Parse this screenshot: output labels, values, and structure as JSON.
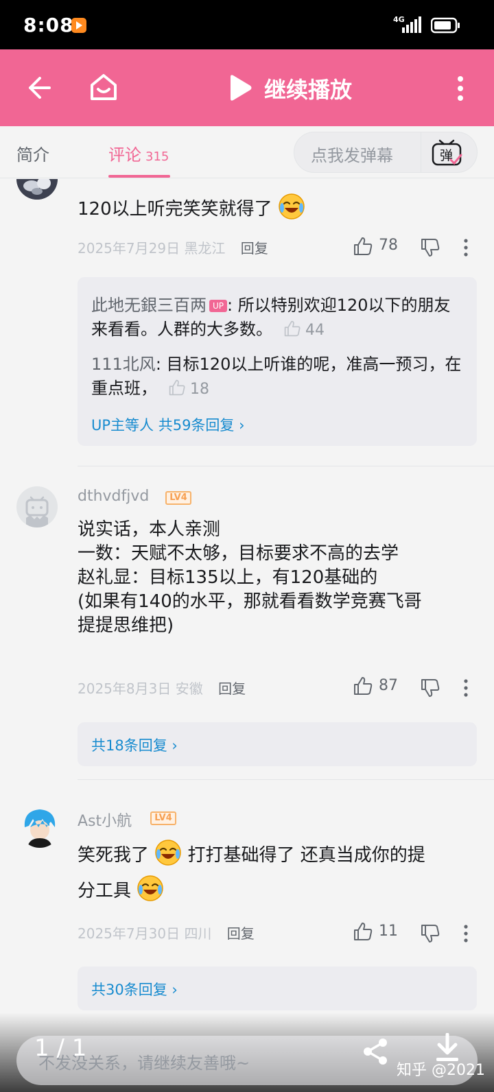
{
  "status_bar": {
    "time": "8:08",
    "network": "4G"
  },
  "header": {
    "continue_label": "继续播放"
  },
  "tabs": {
    "intro": "简介",
    "comments": "评论",
    "comment_count": "315",
    "danmu_placeholder": "点我发弹幕"
  },
  "comments": [
    {
      "text": "120以上听完笑笑就得了",
      "date": "2025年7月29日",
      "location": "黑龙江",
      "reply_label": "回复",
      "likes": "78",
      "sub_replies": [
        {
          "user": "此地无銀三百两",
          "up_badge": "UP",
          "text": "所以特别欢迎120以下的朋友来看看。人群的大多数。",
          "likes": "44"
        },
        {
          "user": "111北风",
          "text": "目标120以上听谁的呢，准高一预习，在重点班，",
          "likes": "18"
        }
      ],
      "more_replies": "UP主等人 共59条回复"
    },
    {
      "user": "dthvdfjvd",
      "level": "LV4",
      "text_lines": [
        "说实话，本人亲测",
        "一数：天赋不太够，目标要求不高的去学",
        "赵礼显：目标135以上，有120基础的",
        "(如果有140的水平，那就看看数学竞赛飞哥",
        "提提思维把)"
      ],
      "date": "2025年8月3日",
      "location": "安徽",
      "reply_label": "回复",
      "likes": "87",
      "more_replies": "共18条回复"
    },
    {
      "user": "Ast小航",
      "level": "LV4",
      "text_part1": "笑死我了",
      "text_part2": "打打基础得了 还真当成你的提",
      "text_part3": "分工具",
      "date": "2025年7月30日",
      "location": "四川",
      "reply_label": "回复",
      "likes": "11",
      "more_replies": "共30条回复"
    }
  ],
  "bottom": {
    "input_hint": "不发没关系，请继续友善哦~",
    "page_count": "1 / 1",
    "watermark": "知乎 @2021"
  },
  "colors": {
    "brand_pink": "#f16694",
    "link_blue": "#178bcf"
  }
}
